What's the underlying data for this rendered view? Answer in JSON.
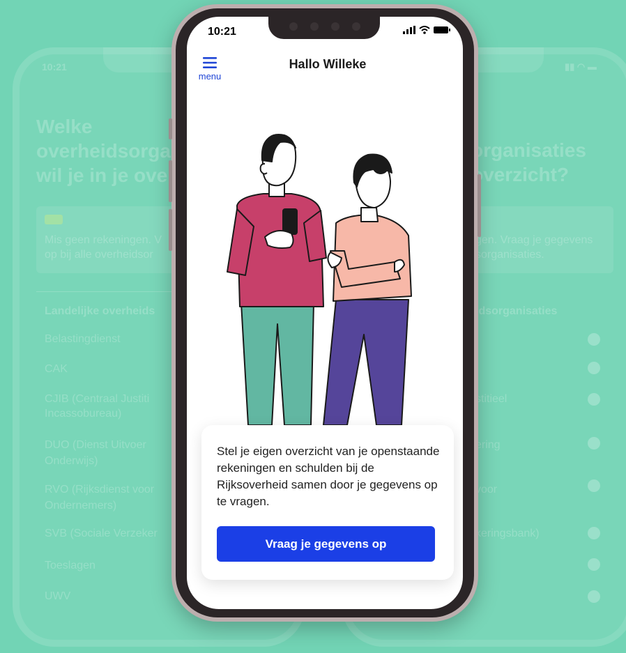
{
  "phone": {
    "status_time": "10:21",
    "header_title": "Hallo Willeke",
    "menu_label": "menu",
    "menu_icon": "hamburger-icon",
    "card_text": "Stel je eigen overzicht van je openstaande rekeningen en schulden bij de Rijksoverheid samen door je gegevens op te vragen.",
    "cta_label": "Vraag je gegevens op",
    "accent_color": "#1b3fe6"
  },
  "background_left": {
    "time": "10:21",
    "title_lines": [
      "Welke",
      "overheidsorga",
      "wil je in je ove"
    ],
    "info_lines": [
      "Mis geen rekeningen. V",
      "op bij alle overheidsor"
    ],
    "section_head": "Landelijke overheids",
    "items": [
      "Belastingdienst",
      "CAK",
      "CJIB (Centraal Justiti",
      "Incassobureau)",
      "DUO (Dienst Uitvoer",
      "Onderwijs)",
      "RVO (Rijksdienst voor",
      "Ondernemers)",
      "SVB (Sociale Verzeker",
      "Toeslagen",
      "UWV"
    ]
  },
  "background_right": {
    "title_lines": [
      "organisaties",
      "overzicht?"
    ],
    "info_lines": [
      "gen. Vraag je gegevens",
      "sorganisaties."
    ],
    "section_head": "idsorganisaties",
    "items": [
      "stitieel",
      "ering",
      "voor",
      "keringsbank)"
    ]
  }
}
